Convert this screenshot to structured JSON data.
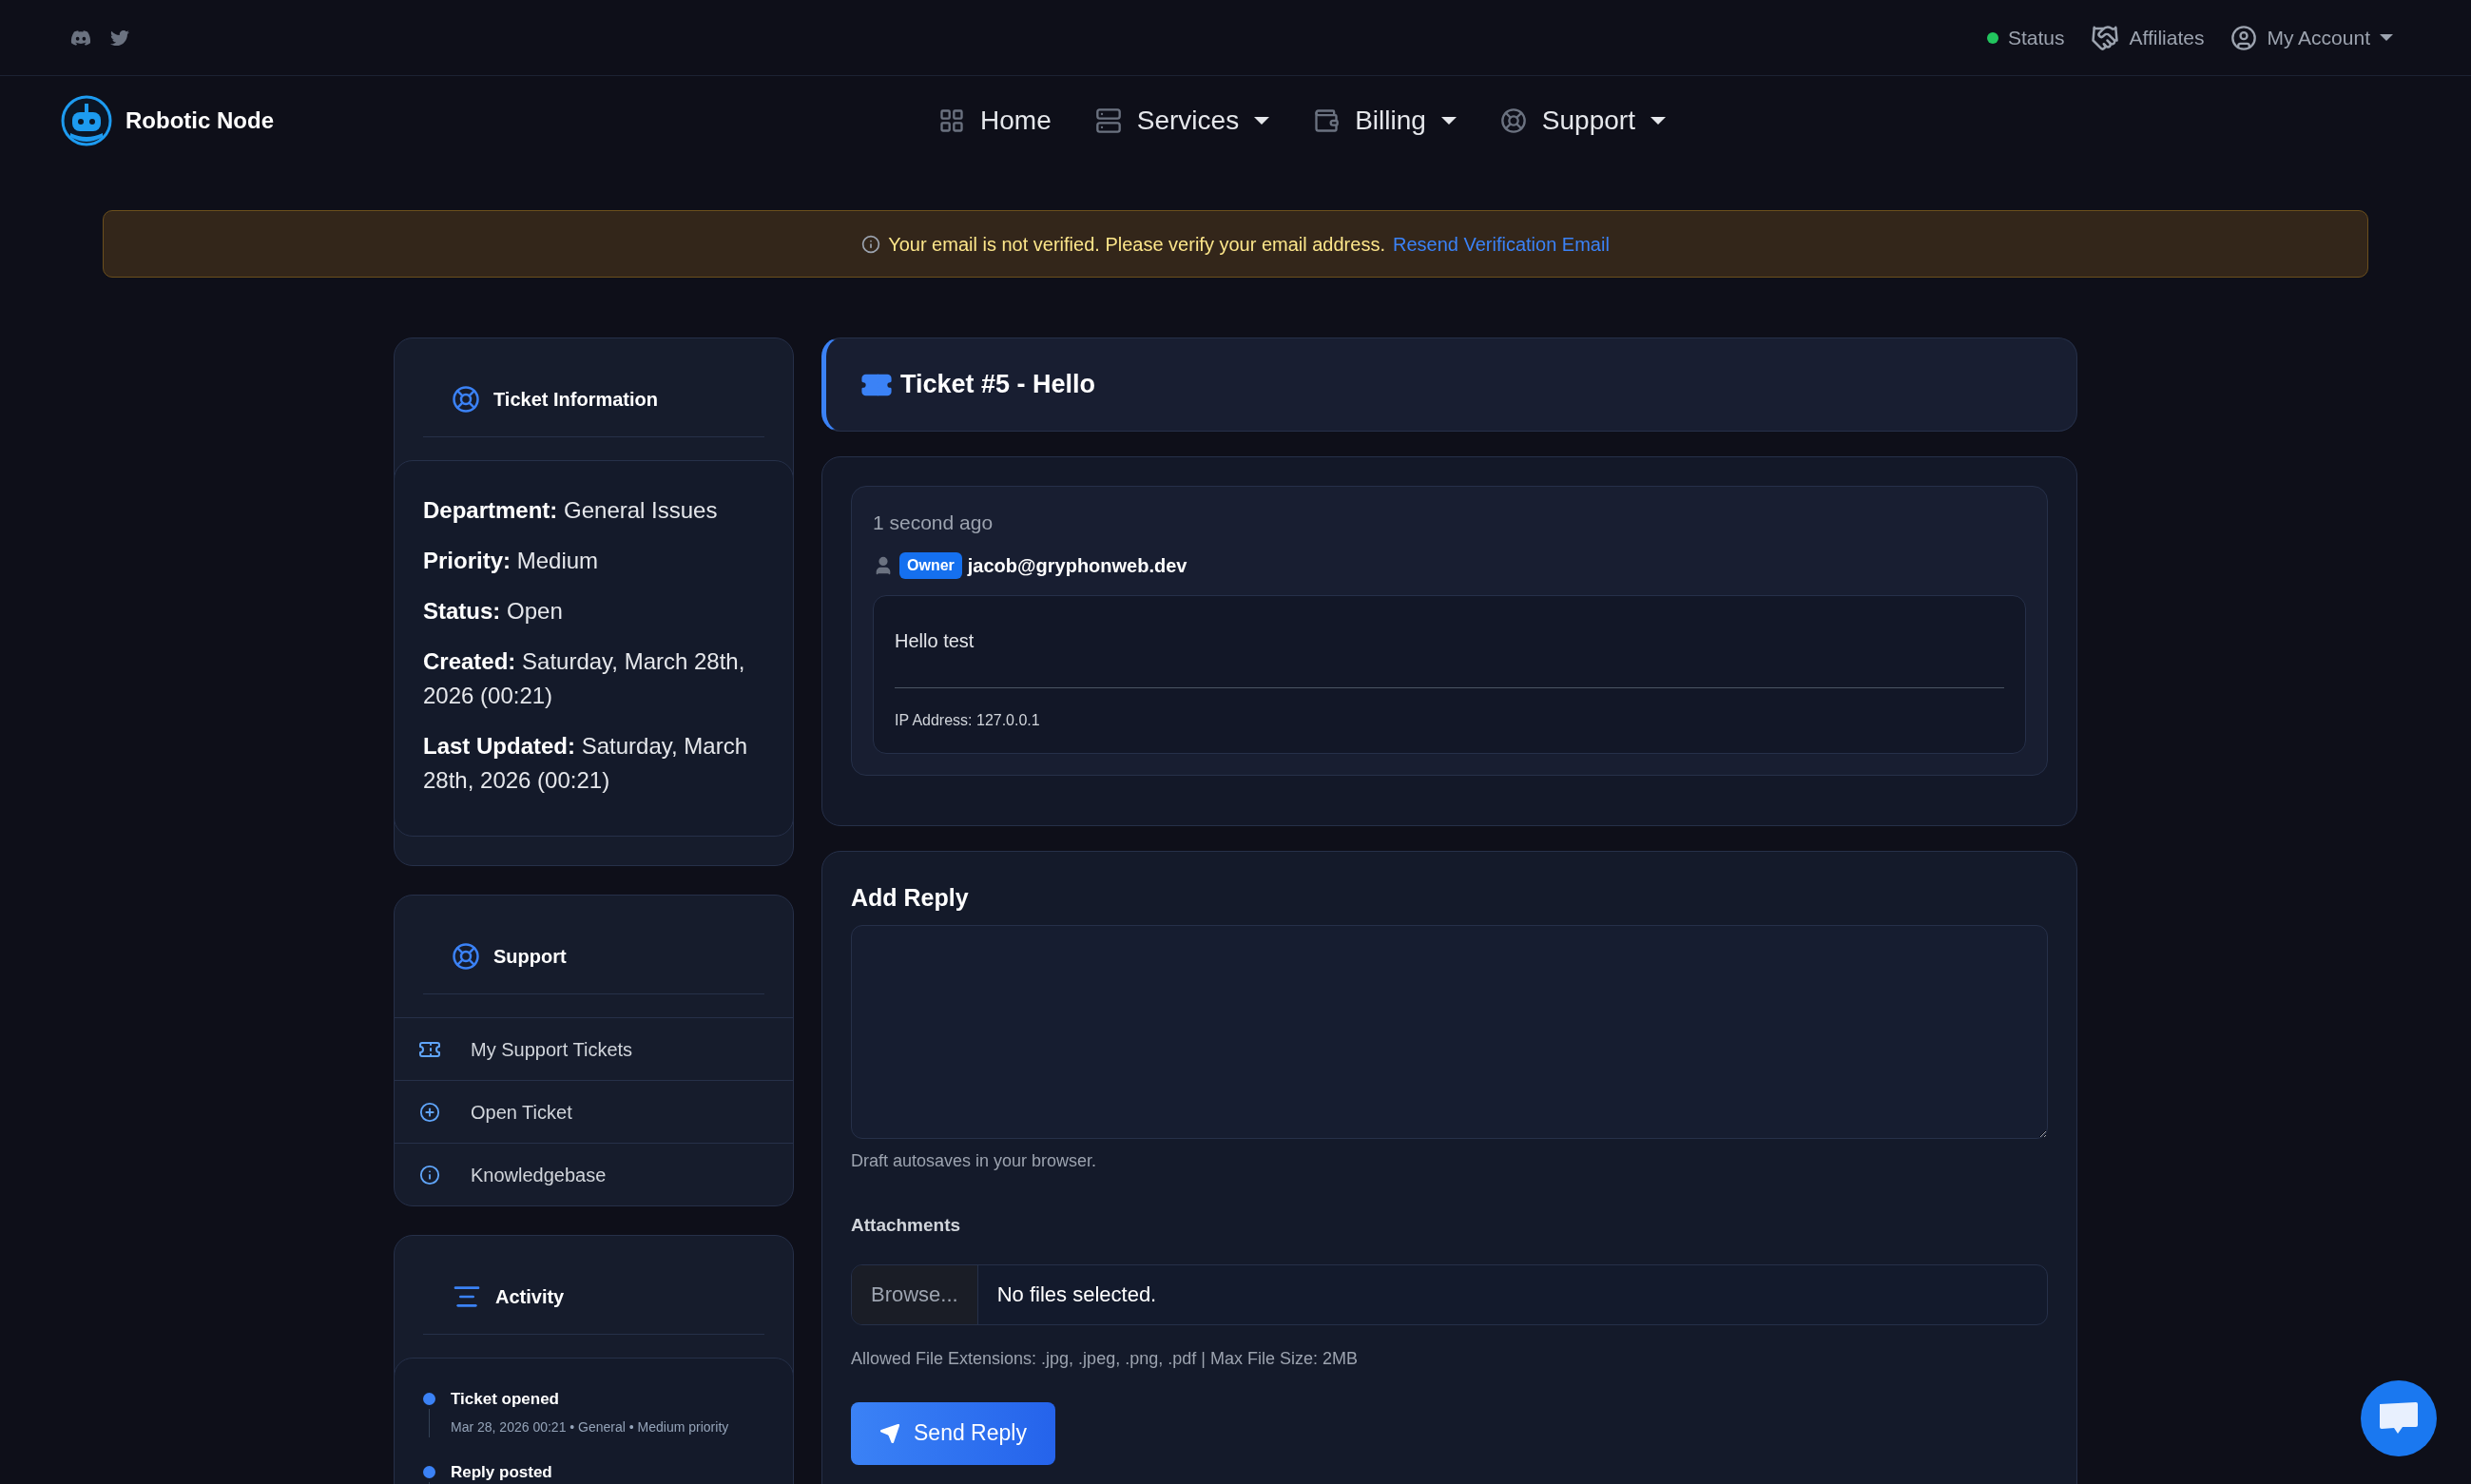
{
  "top_links": [
    {
      "label": "Status",
      "kind": "status",
      "dropdown": false
    },
    {
      "label": "Affiliates",
      "kind": "affiliates",
      "dropdown": false
    },
    {
      "label": "My Account",
      "kind": "account",
      "dropdown": true
    }
  ],
  "brand": "Robotic Node",
  "nav": [
    {
      "label": "Home",
      "kind": "home",
      "dropdown": false
    },
    {
      "label": "Services",
      "kind": "services",
      "dropdown": true
    },
    {
      "label": "Billing",
      "kind": "billing",
      "dropdown": true
    },
    {
      "label": "Support",
      "kind": "support",
      "dropdown": true
    }
  ],
  "alert": {
    "text": "Your email is not verified. Please verify your email address.",
    "link": "Resend Verification Email"
  },
  "ticket_info": {
    "title": "Ticket Information",
    "fields": [
      {
        "label": "Department:",
        "value": "General Issues"
      },
      {
        "label": "Priority:",
        "value": "Medium"
      },
      {
        "label": "Status:",
        "value": "Open"
      },
      {
        "label": "Created:",
        "value": "Saturday, March 28th, 2026 (00:21)"
      },
      {
        "label": "Last Updated:",
        "value": "Saturday, March 28th, 2026 (00:21)"
      }
    ]
  },
  "support_menu": {
    "title": "Support",
    "items": [
      {
        "label": "My Support Tickets",
        "kind": "ticket"
      },
      {
        "label": "Open Ticket",
        "kind": "open"
      },
      {
        "label": "Knowledgebase",
        "kind": "knowledge"
      }
    ]
  },
  "activity": {
    "title": "Activity",
    "events": [
      {
        "title": "Ticket opened",
        "detail": "Mar 28, 2026 00:21 • General • Medium priority"
      },
      {
        "title": "Reply posted"
      }
    ]
  },
  "ticket": {
    "title": "Ticket #5 - Hello"
  },
  "messages": [
    {
      "time": "1 second ago",
      "role": "Owner",
      "author": "jacob@gryphonweb.dev",
      "body": "Hello test",
      "ip": "IP Address: 127.0.0.1"
    }
  ],
  "reply": {
    "title": "Add Reply",
    "hint": "Draft autosaves in your browser.",
    "attachments_label": "Attachments",
    "browse": "Browse...",
    "file_status": "No files selected.",
    "file_note": "Allowed File Extensions: .jpg, .jpeg, .png, .pdf | Max File Size: 2MB",
    "submit": "Send Reply"
  }
}
